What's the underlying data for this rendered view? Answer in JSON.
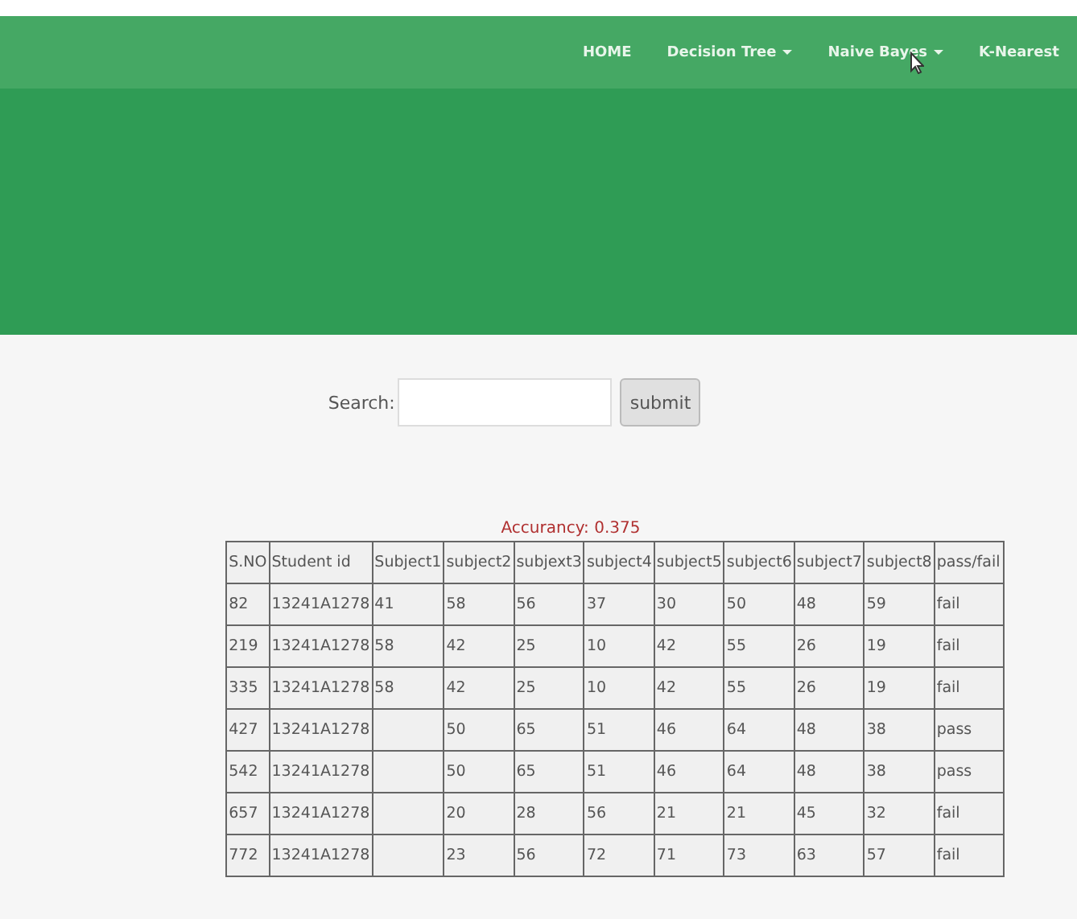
{
  "nav": {
    "items": [
      {
        "label": "HOME",
        "dropdown": false
      },
      {
        "label": "Decision Tree",
        "dropdown": true
      },
      {
        "label": "Naive Bayes",
        "dropdown": true
      },
      {
        "label": "K-Nearest",
        "dropdown": false
      }
    ]
  },
  "search": {
    "label": "Search:",
    "button": "submit"
  },
  "accuracy": "Accurancy: 0.375",
  "table": {
    "columns": [
      "S.NO",
      "Student id",
      "Subject1",
      "subject2",
      "subjext3",
      "subject4",
      "subject5",
      "subject6",
      "subject7",
      "subject8",
      "pass/fail"
    ],
    "rows": [
      [
        "82",
        "13241A1278",
        "41",
        "58",
        "56",
        "37",
        "30",
        "50",
        "48",
        "59",
        "fail"
      ],
      [
        "219",
        "13241A1278",
        "58",
        "42",
        "25",
        "10",
        "42",
        "55",
        "26",
        "19",
        "fail"
      ],
      [
        "335",
        "13241A1278",
        "58",
        "42",
        "25",
        "10",
        "42",
        "55",
        "26",
        "19",
        "fail"
      ],
      [
        "427",
        "13241A1278",
        null,
        "50",
        "65",
        "51",
        "46",
        "64",
        "48",
        "38",
        "pass"
      ],
      [
        "542",
        "13241A1278",
        null,
        "50",
        "65",
        "51",
        "46",
        "64",
        "48",
        "38",
        "pass"
      ],
      [
        "657",
        "13241A1278",
        null,
        "20",
        "28",
        "56",
        "21",
        "21",
        "45",
        "32",
        "fail"
      ],
      [
        "772",
        "13241A1278",
        null,
        "23",
        "56",
        "72",
        "71",
        "73",
        "63",
        "57",
        "fail"
      ]
    ]
  }
}
